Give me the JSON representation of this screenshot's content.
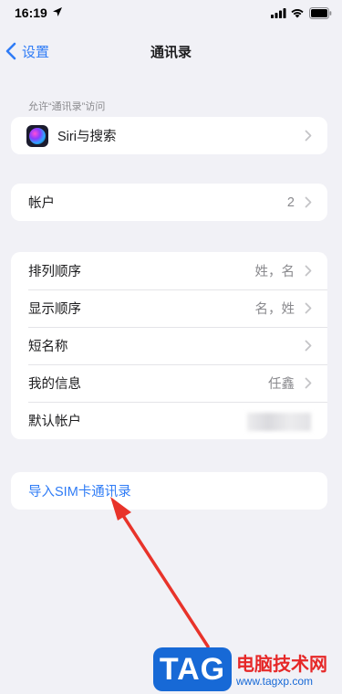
{
  "status_bar": {
    "time": "16:19"
  },
  "nav": {
    "back_label": "设置",
    "title": "通讯录"
  },
  "access_section": {
    "header": "允许“通讯录”访问",
    "siri_label": "Siri与搜索"
  },
  "accounts": {
    "label": "帐户",
    "value": "2"
  },
  "settings_rows": [
    {
      "label": "排列顺序",
      "value": "姓，名"
    },
    {
      "label": "显示顺序",
      "value": "名，姓"
    },
    {
      "label": "短名称",
      "value": ""
    },
    {
      "label": "我的信息",
      "value": "任鑫"
    },
    {
      "label": "默认帐户",
      "value": ""
    }
  ],
  "import": {
    "label": "导入SIM卡通讯录"
  },
  "watermark": {
    "logo": "TAG",
    "title": "电脑技术网",
    "url": "www.tagxp.com"
  },
  "colors": {
    "accent": "#2f7cf6",
    "arrow": "#e8332a",
    "background": "#f1f1f6"
  }
}
